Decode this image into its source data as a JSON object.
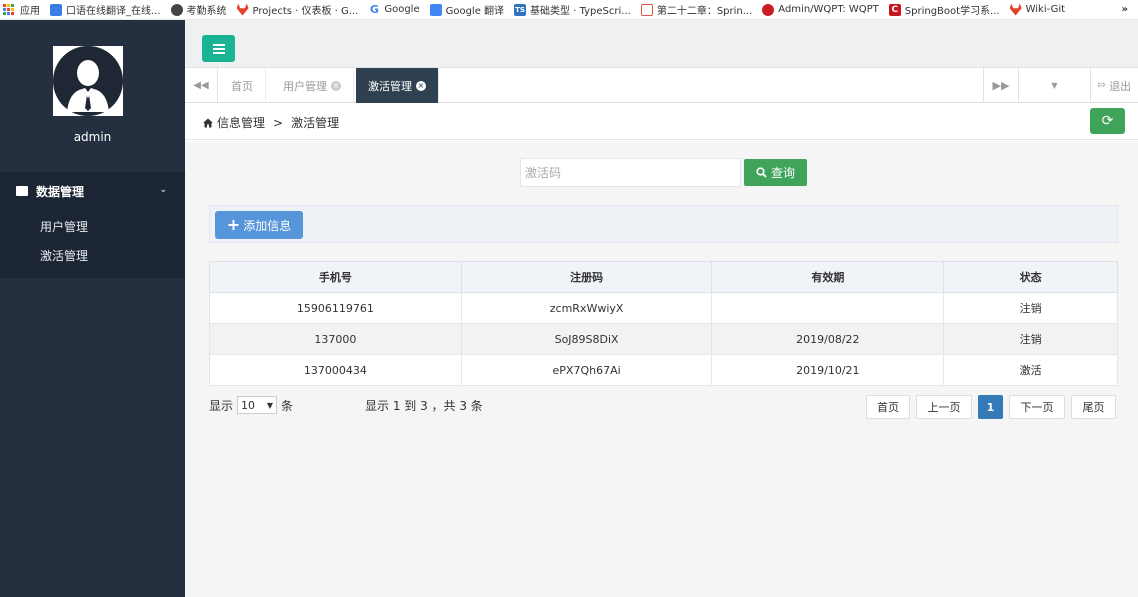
{
  "bookmarks": [
    {
      "label": "应用",
      "icon": "apps-icon",
      "color": "#4285f4"
    },
    {
      "label": "口语在线翻译_在线...",
      "icon": "translate-icon",
      "color": "#3b7de6"
    },
    {
      "label": "考勤系统",
      "icon": "globe-icon",
      "color": "#444444"
    },
    {
      "label": "Projects · 仪表板 · G...",
      "icon": "gitlab-icon",
      "color": "#e24329"
    },
    {
      "label": "Google",
      "icon": "google-icon",
      "color": "#4285f4"
    },
    {
      "label": "Google 翻译",
      "icon": "google-translate-icon",
      "color": "#4285f4"
    },
    {
      "label": "基础类型 · TypeScri...",
      "icon": "typescript-icon",
      "color": "#2f74c0"
    },
    {
      "label": "第二十二章：Sprin...",
      "icon": "book-icon",
      "color": "#e2543a"
    },
    {
      "label": "Admin/WQPT: WQPT",
      "icon": "gitee-icon",
      "color": "#c71d23"
    },
    {
      "label": "SpringBoot学习系...",
      "icon": "csdn-icon",
      "color": "#c9151e"
    },
    {
      "label": "Wiki-Git",
      "icon": "gitlab-icon",
      "color": "#e24329"
    }
  ],
  "bookmarks_more": "»",
  "sidebar": {
    "username": "admin",
    "group_label": "数据管理",
    "items": [
      {
        "label": "用户管理"
      },
      {
        "label": "激活管理"
      }
    ]
  },
  "tabs": [
    {
      "label": "首页",
      "closable": false,
      "active": false
    },
    {
      "label": "用户管理",
      "closable": true,
      "active": false
    },
    {
      "label": "激活管理",
      "closable": true,
      "active": true
    }
  ],
  "tab_close_glyph": "×",
  "logout_label": "退出",
  "breadcrumb": {
    "parent": "信息管理",
    "separator": ">",
    "current": "激活管理"
  },
  "search": {
    "placeholder": "激活码",
    "button_label": "查询"
  },
  "add_button_label": "添加信息",
  "table": {
    "columns": [
      "手机号",
      "注册码",
      "有效期",
      "状态"
    ],
    "rows": [
      [
        "15906119761",
        "zcmRxWwiyX",
        "",
        "注销"
      ],
      [
        "137000",
        "SoJ89S8DiX",
        "2019/08/22",
        "注销"
      ],
      [
        "137000434",
        "ePX7Qh67Ai",
        "2019/10/21",
        "激活"
      ]
    ]
  },
  "pagination": {
    "show_label": "显示",
    "page_size": "10",
    "unit_label": "条",
    "summary": "显示 1 到 3 ，共 3 条",
    "first": "首页",
    "prev": "上一页",
    "current": "1",
    "next": "下一页",
    "last": "尾页"
  },
  "colors": {
    "sidebar_bg": "#243040",
    "active_tab_bg": "#2f4050",
    "primary_green": "#3fa45a",
    "teal": "#1ab394",
    "blue_button": "#5695d9",
    "page_active": "#337ab7"
  }
}
